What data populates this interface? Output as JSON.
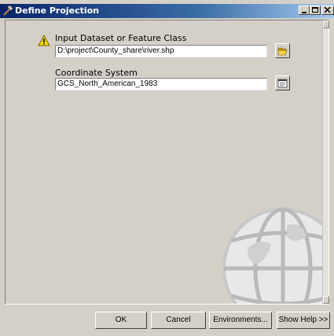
{
  "window": {
    "title": "Define Projection"
  },
  "form": {
    "input_label": "Input Dataset or Feature Class",
    "input_value": "D:\\project\\County_share\\river.shp",
    "input_status_icon": "warning-icon",
    "coord_label": "Coordinate System",
    "coord_value": "GCS_North_American_1983"
  },
  "buttons": {
    "ok": "OK",
    "cancel": "Cancel",
    "environments": "Environments...",
    "show_help": "Show Help >>"
  },
  "icons": {
    "title": "hammer-icon",
    "browse": "folder-open-icon",
    "properties": "spatial-reference-properties-icon",
    "background": "globe-icon"
  },
  "colors": {
    "titlebar_start": "#0a246a",
    "titlebar_end": "#a6caf0",
    "dialog_face": "#d4d0c8",
    "warning": "#f2d400"
  }
}
